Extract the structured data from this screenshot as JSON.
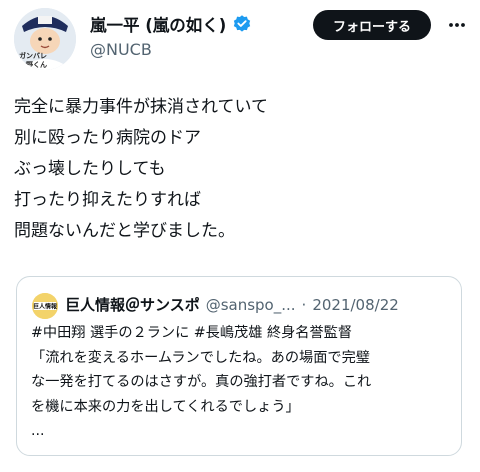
{
  "tweet": {
    "author": {
      "name": "嵐一平 (嵐の如く)",
      "handle": "@NUCB",
      "avatar_icon": "cartoon-avatar-icon",
      "avatar_text": "ガンバレ大野くん",
      "verified": true
    },
    "follow_label": "フォローする",
    "text_lines": [
      "完全に暴力事件が抹消されていて",
      "別に殴ったり病院のドア",
      "ぶっ壊したりしても",
      "打ったり抑えたりすれば",
      "問題ないんだと学びました。"
    ]
  },
  "quote": {
    "avatar_text": "巨人情報",
    "name": "巨人情報＠サンスポ",
    "handle": "@sanspo_...",
    "separator": "·",
    "date": "2021/08/22",
    "body_lines": [
      "#中田翔 選手の２ランに #長嶋茂雄 終身名誉監督",
      "「流れを変えるホームランでしたね。あの場面で完璧",
      "な一発を打てるのはさすが。真の強打者ですね。これ",
      "を機に本来の力を出してくれるでしょう」",
      "..."
    ]
  },
  "colors": {
    "verified_badge": "#1d9bf0",
    "follow_button": "#0f1419",
    "secondary_text": "#536471",
    "card_border": "#cfd9de"
  }
}
